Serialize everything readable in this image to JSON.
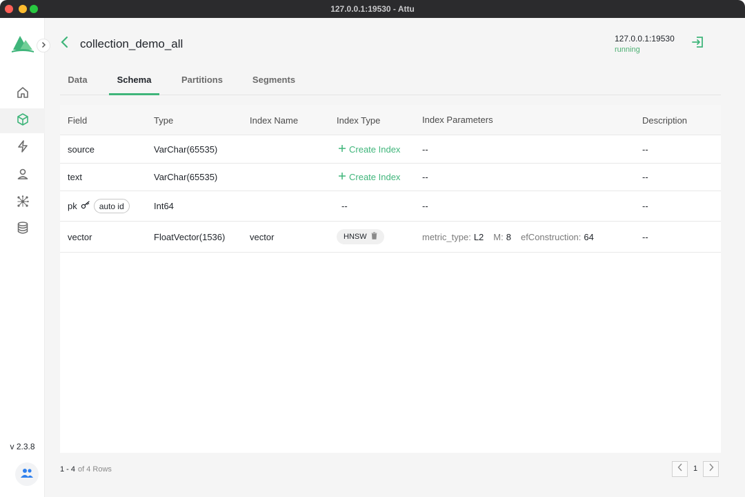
{
  "window": {
    "title": "127.0.0.1:19530 - Attu"
  },
  "sidebar": {
    "items": [
      {
        "icon": "home-icon"
      },
      {
        "icon": "collection-cube-icon"
      },
      {
        "icon": "lightning-icon"
      },
      {
        "icon": "user-icon"
      },
      {
        "icon": "network-icon"
      },
      {
        "icon": "database-icon"
      }
    ],
    "active_index": 1,
    "version": "v 2.3.8"
  },
  "header": {
    "title": "collection_demo_all",
    "server_address": "127.0.0.1:19530",
    "server_status": "running"
  },
  "tabs": [
    {
      "label": "Data"
    },
    {
      "label": "Schema"
    },
    {
      "label": "Partitions"
    },
    {
      "label": "Segments"
    }
  ],
  "active_tab": "Schema",
  "table": {
    "columns": [
      "Field",
      "Type",
      "Index Name",
      "Index Type",
      "Index Parameters",
      "Description"
    ],
    "rows": [
      {
        "field": "source",
        "type": "VarChar(65535)",
        "index_name": "",
        "index_type_action": "Create Index",
        "index_params": "--",
        "description": "--"
      },
      {
        "field": "text",
        "type": "VarChar(65535)",
        "index_name": "",
        "index_type_action": "Create Index",
        "index_params": "--",
        "description": "--"
      },
      {
        "field": "pk",
        "field_chip": "auto id",
        "type": "Int64",
        "index_name": "",
        "index_type": "--",
        "index_params": "--",
        "description": "--"
      },
      {
        "field": "vector",
        "type": "FloatVector(1536)",
        "index_name": "vector",
        "index_type": "HNSW",
        "params": [
          {
            "key": "metric_type:",
            "value": "L2"
          },
          {
            "key": "M:",
            "value": "8"
          },
          {
            "key": "efConstruction:",
            "value": "64"
          }
        ],
        "description": "--"
      }
    ]
  },
  "footer": {
    "range": "1 - 4",
    "total": "of 4 Rows",
    "page": "1"
  },
  "colors": {
    "accent": "#3fb57a",
    "background": "#f5f5f5"
  }
}
